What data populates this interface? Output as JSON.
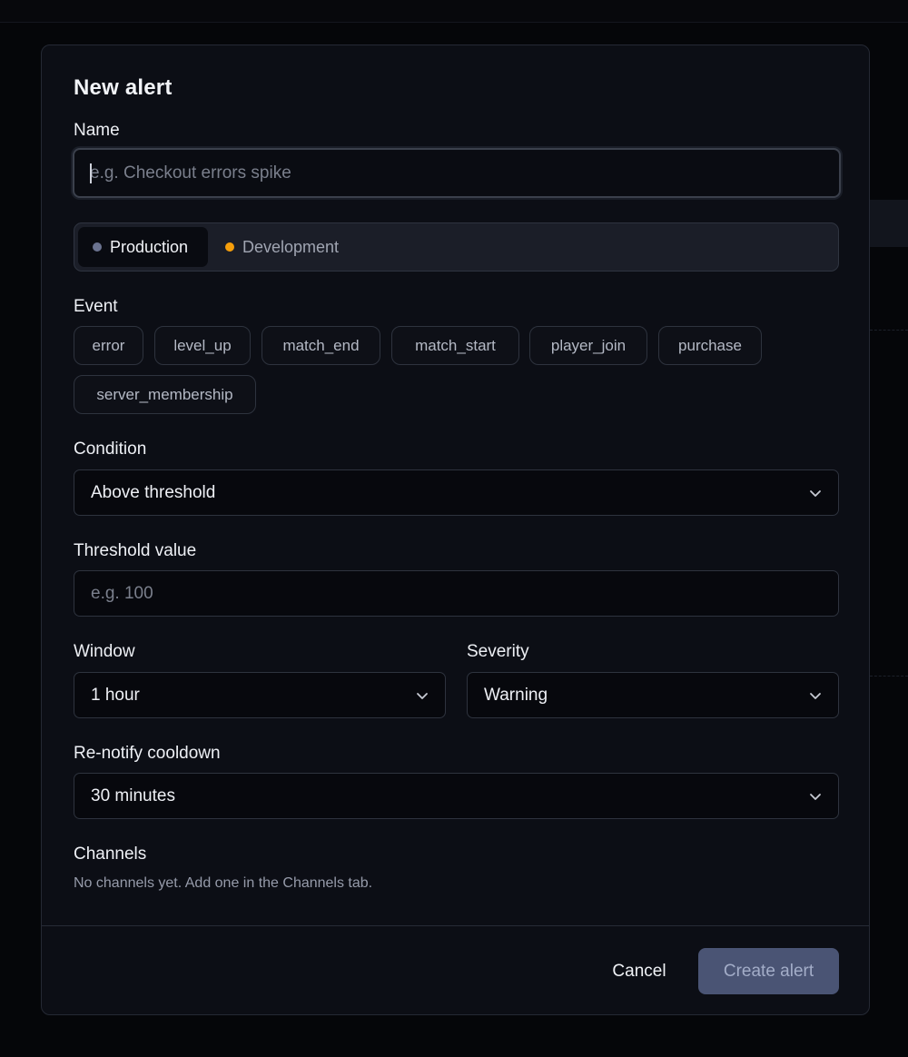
{
  "modal": {
    "title": "New alert",
    "name": {
      "label": "Name",
      "placeholder": "e.g. Checkout errors spike",
      "value": ""
    },
    "environment": {
      "options": [
        {
          "label": "Production",
          "dot_color": "#6b7390",
          "selected": true
        },
        {
          "label": "Development",
          "dot_color": "#f59e0b",
          "selected": false
        }
      ]
    },
    "event": {
      "label": "Event",
      "chips": [
        "error",
        "level_up",
        "match_end",
        "match_start",
        "player_join",
        "purchase",
        "server_membership"
      ]
    },
    "condition": {
      "label": "Condition",
      "value": "Above threshold",
      "icon": "chevron-down-icon"
    },
    "threshold": {
      "label": "Threshold value",
      "placeholder": "e.g. 100",
      "value": ""
    },
    "window": {
      "label": "Window",
      "value": "1 hour",
      "icon": "chevron-down-icon"
    },
    "severity": {
      "label": "Severity",
      "value": "Warning",
      "icon": "chevron-down-icon"
    },
    "cooldown": {
      "label": "Re-notify cooldown",
      "value": "30 minutes",
      "icon": "chevron-down-icon"
    },
    "channels": {
      "label": "Channels",
      "empty_text": "No channels yet. Add one in the Channels tab."
    },
    "footer": {
      "cancel_label": "Cancel",
      "create_label": "Create alert"
    }
  },
  "colors": {
    "background": "#050609",
    "modal_bg": "#0c0e15",
    "border": "#2e333e",
    "primary_button": "#4a5474"
  }
}
